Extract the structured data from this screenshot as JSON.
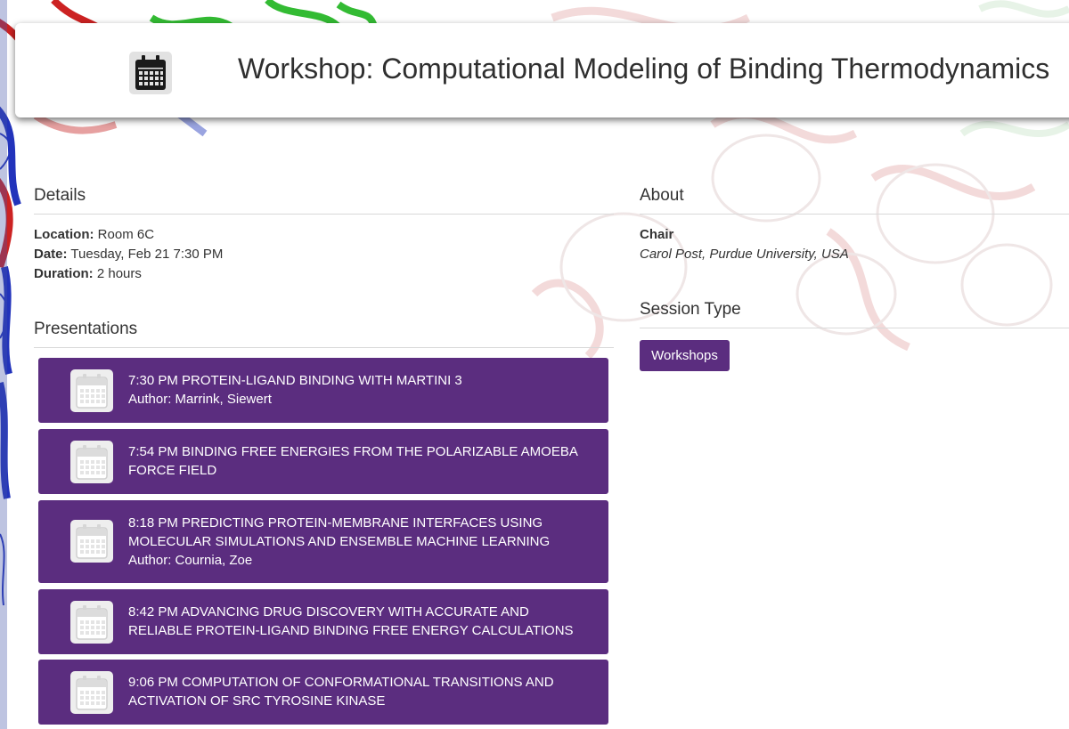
{
  "header": {
    "title": "Workshop: Computational Modeling of Binding Thermodynamics",
    "icon": "calendar-icon"
  },
  "details": {
    "heading": "Details",
    "location_label": "Location:",
    "location_value": "Room 6C",
    "date_label": "Date:",
    "date_value": "Tuesday, Feb 21 7:30 PM",
    "duration_label": "Duration:",
    "duration_value": "2 hours"
  },
  "about": {
    "heading": "About",
    "chair_label": "Chair",
    "chair_value": "Carol Post, Purdue University, USA"
  },
  "session_type": {
    "heading": "Session Type",
    "button_label": "Workshops"
  },
  "presentations": {
    "heading": "Presentations",
    "items": [
      {
        "title": "7:30 PM PROTEIN-LIGAND BINDING WITH MARTINI 3",
        "author": "Author: Marrink, Siewert"
      },
      {
        "title": "7:54 PM BINDING FREE ENERGIES FROM THE POLARIZABLE AMOEBA FORCE FIELD",
        "author": ""
      },
      {
        "title": "8:18 PM PREDICTING PROTEIN-MEMBRANE INTERFACES USING MOLECULAR SIMULATIONS AND ENSEMBLE MACHINE LEARNING",
        "author": "Author: Cournia, Zoe"
      },
      {
        "title": "8:42 PM ADVANCING DRUG DISCOVERY WITH ACCURATE AND RELIABLE PROTEIN-LIGAND BINDING FREE ENERGY CALCULATIONS",
        "author": ""
      },
      {
        "title": "9:06 PM COMPUTATION OF CONFORMATIONAL TRANSITIONS AND ACTIVATION OF SRC TYROSINE KINASE",
        "author": ""
      }
    ]
  },
  "colors": {
    "accent_purple": "#5b2d7f",
    "ribbon_red": "#cc2222",
    "ribbon_blue": "#2233bb",
    "ribbon_green": "#33bb33"
  }
}
